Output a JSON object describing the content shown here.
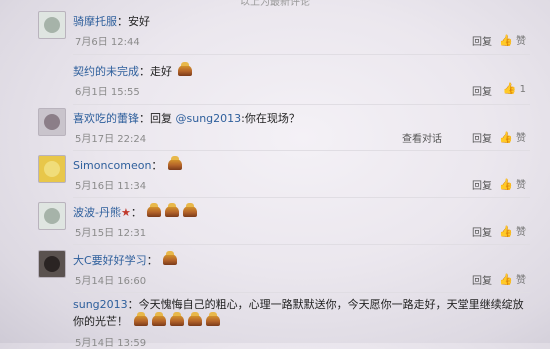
{
  "header": {
    "title": "以上为最新评论"
  },
  "comments": [
    {
      "user": "骑摩托服",
      "text": "安好",
      "date": "7月6日 12:44",
      "reply": "回复",
      "like": "赞"
    },
    {
      "user": "契约的未完成",
      "text": "走好",
      "date": "6月1日 15:55",
      "reply": "回复",
      "like": "1"
    },
    {
      "user": "喜欢吃的蕾锋",
      "text": "回复",
      "mention": "@sung2013",
      "text2": ":你在现场？",
      "date": "5月17日 22:24",
      "view": "查看对话",
      "reply": "回复",
      "like": "赞"
    },
    {
      "user": "Simoncomeon",
      "text": "",
      "date": "5月16日 11:34",
      "reply": "回复",
      "like": "赞"
    },
    {
      "user": "波波-丹熊",
      "text": "",
      "date": "5月15日 12:31",
      "reply": "回复",
      "like": "赞"
    },
    {
      "user": "大C要好好学习",
      "text": "",
      "date": "5月14日 16:60",
      "reply": "回复",
      "like": "赞"
    },
    {
      "user": "sung2013",
      "text": "今天愧悔自己的粗心，心理一路默默送你，今天愿你一路走好，天堂里继续绽放你的光芒！",
      "date": "5月14日 13:59"
    }
  ]
}
